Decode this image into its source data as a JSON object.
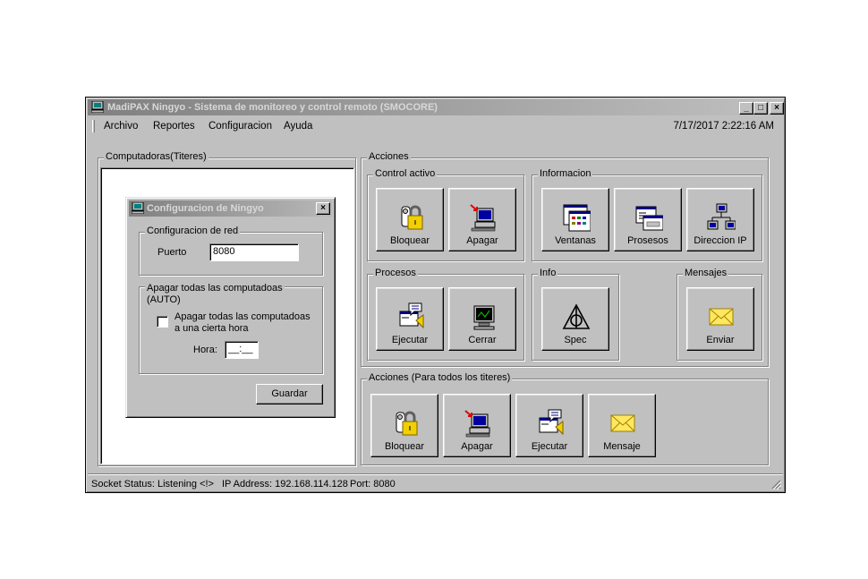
{
  "window": {
    "title": "MadiPAX Ningyo - Sistema de monitoreo y control remoto (SMOCORE)",
    "min": "_",
    "max": "□",
    "close": "×"
  },
  "menu": [
    "Archivo",
    "Reportes",
    "Configuracion",
    "Ayuda"
  ],
  "clock": "7/17/2017 2:22:16 AM",
  "left_group": "Computadoras(Titeres)",
  "acciones": {
    "title": "Acciones",
    "control_activo": {
      "title": "Control activo",
      "buttons": [
        "Bloquear",
        "Apagar"
      ]
    },
    "informacion": {
      "title": "Informacion",
      "buttons": [
        "Ventanas",
        "Prosesos",
        "Direccion IP"
      ]
    },
    "procesos": {
      "title": "Procesos",
      "buttons": [
        "Ejecutar",
        "Cerrar"
      ]
    },
    "info": {
      "title": "Info",
      "buttons": [
        "Spec"
      ]
    },
    "mensajes": {
      "title": "Mensajes",
      "buttons": [
        "Enviar"
      ]
    }
  },
  "todos": {
    "title": "Acciones (Para todos los titeres)",
    "buttons": [
      "Bloquear",
      "Apagar",
      "Ejecutar",
      "Mensaje"
    ]
  },
  "dialog": {
    "title": "Configuracion de Ningyo",
    "red_group": "Configuracion de red",
    "puerto_label": "Puerto",
    "puerto_value": "8080",
    "apagar_group_line1": "Apagar todas las computadoas",
    "apagar_group_line2": "(AUTO)",
    "checkbox_line1": "Apagar todas las computadoas",
    "checkbox_line2": "a una cierta hora",
    "hora_label": "Hora:",
    "hora_value": "__:__",
    "save": "Guardar"
  },
  "status": {
    "socket": "Socket Status: Listening <!>",
    "ip": "IP Address: 192.168.114.128",
    "port": "Port: 8080"
  }
}
